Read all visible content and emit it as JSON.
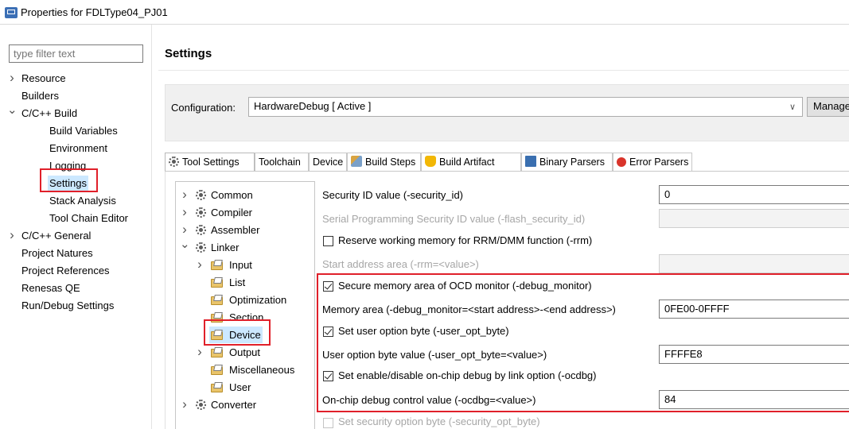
{
  "window": {
    "title": "Properties for FDLType04_PJ01"
  },
  "filter": {
    "placeholder": "type filter text"
  },
  "left_tree": [
    {
      "label": "Resource",
      "twisty": "closed"
    },
    {
      "label": "Builders",
      "twisty": ""
    },
    {
      "label": "C/C++ Build",
      "twisty": "open"
    },
    {
      "label": "Build Variables",
      "twisty": ""
    },
    {
      "label": "Environment",
      "twisty": ""
    },
    {
      "label": "Logging",
      "twisty": ""
    },
    {
      "label": "Settings",
      "twisty": "",
      "selected": true
    },
    {
      "label": "Stack Analysis",
      "twisty": ""
    },
    {
      "label": "Tool Chain Editor",
      "twisty": ""
    },
    {
      "label": "C/C++ General",
      "twisty": "closed"
    },
    {
      "label": "Project Natures",
      "twisty": ""
    },
    {
      "label": "Project References",
      "twisty": ""
    },
    {
      "label": "Renesas QE",
      "twisty": ""
    },
    {
      "label": "Run/Debug Settings",
      "twisty": ""
    }
  ],
  "settings": {
    "title": "Settings",
    "configuration_label": "Configuration:",
    "configuration_value": "HardwareDebug  [ Active ]",
    "manage_label": "Manage"
  },
  "tabs": [
    {
      "label": "Tool Settings",
      "icon": "gear-icon"
    },
    {
      "label": "Toolchain",
      "icon": ""
    },
    {
      "label": "Device",
      "icon": ""
    },
    {
      "label": "Build Steps",
      "icon": "build-steps-icon"
    },
    {
      "label": "Build Artifact",
      "icon": "build-artifact-icon"
    },
    {
      "label": "Binary Parsers",
      "icon": "binary-parsers-icon"
    },
    {
      "label": "Error Parsers",
      "icon": "error-icon"
    }
  ],
  "tool_tree": [
    {
      "label": "Common",
      "icon": "gear",
      "twisty": "closed"
    },
    {
      "label": "Compiler",
      "icon": "gear",
      "twisty": "closed"
    },
    {
      "label": "Assembler",
      "icon": "gear",
      "twisty": "closed"
    },
    {
      "label": "Linker",
      "icon": "gear",
      "twisty": "open"
    },
    {
      "label": "Input",
      "icon": "folder",
      "twisty": "closed"
    },
    {
      "label": "List",
      "icon": "folder",
      "twisty": ""
    },
    {
      "label": "Optimization",
      "icon": "folder",
      "twisty": ""
    },
    {
      "label": "Section",
      "icon": "folder",
      "twisty": ""
    },
    {
      "label": "Device",
      "icon": "folder",
      "twisty": "",
      "selected": true
    },
    {
      "label": "Output",
      "icon": "folder",
      "twisty": "closed"
    },
    {
      "label": "Miscellaneous",
      "icon": "folder",
      "twisty": ""
    },
    {
      "label": "User",
      "icon": "folder",
      "twisty": ""
    },
    {
      "label": "Converter",
      "icon": "gear",
      "twisty": "closed"
    }
  ],
  "options": {
    "security_id_label": "Security ID value (-security_id)",
    "security_id_value": "0",
    "flash_security_label": "Serial Programming Security ID value (-flash_security_id)",
    "flash_security_value": "",
    "rrm_label": "Reserve working memory for RRM/DMM function (-rrm)",
    "rrm_checked": false,
    "rrm_start_label": "Start address area (-rrm=<value>)",
    "rrm_start_value": "",
    "debug_monitor_label": "Secure memory area of OCD monitor (-debug_monitor)",
    "debug_monitor_checked": true,
    "memory_area_label": "Memory area (-debug_monitor=<start address>-<end address>)",
    "memory_area_value": "0FE00-0FFFF",
    "user_opt_byte_label": "Set user option byte (-user_opt_byte)",
    "user_opt_byte_checked": true,
    "user_opt_value_label": "User option byte value (-user_opt_byte=<value>)",
    "user_opt_value": "FFFFE8",
    "ocdbg_label": "Set enable/disable on-chip debug by link option (-ocdbg)",
    "ocdbg_checked": true,
    "ocdbg_value_label": "On-chip debug control value (-ocdbg=<value>)",
    "ocdbg_value": "84",
    "security_opt_label": "Set security option byte (-security_opt_byte)",
    "security_opt_checked": false
  },
  "colors": {
    "highlight_box": "#e0202a",
    "selection": "#cce8ff"
  }
}
